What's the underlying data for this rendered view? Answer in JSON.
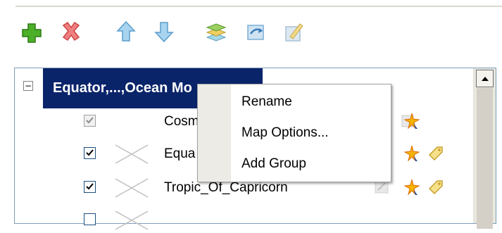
{
  "toolbar": {
    "buttons": [
      {
        "name": "add-icon",
        "color": "#4caf28"
      },
      {
        "name": "delete-icon",
        "color": "#e23b3b"
      },
      {
        "name": "move-up-icon",
        "color": "#6fb6e8"
      },
      {
        "name": "move-down-icon",
        "color": "#6fb6e8"
      },
      {
        "name": "layers-icon",
        "color": "#8cc63f"
      },
      {
        "name": "map-refresh-icon",
        "color": "#7aaed6"
      },
      {
        "name": "map-edit-icon",
        "color": "#a9c0d6"
      }
    ]
  },
  "tree": {
    "group_label": "Equator,...,Ocean Mo",
    "expander": "−",
    "layers": [
      {
        "name": "Cosm",
        "checked": true,
        "disabled": true
      },
      {
        "name": "Equa",
        "checked": true,
        "disabled": false
      },
      {
        "name": "Tropic_Of_Capricorn",
        "checked": true,
        "disabled": false
      }
    ]
  },
  "context_menu": {
    "items": [
      "Rename",
      "Map Options...",
      "Add Group"
    ]
  },
  "colors": {
    "selection": "#0a246a",
    "border": "#7f9db9"
  }
}
